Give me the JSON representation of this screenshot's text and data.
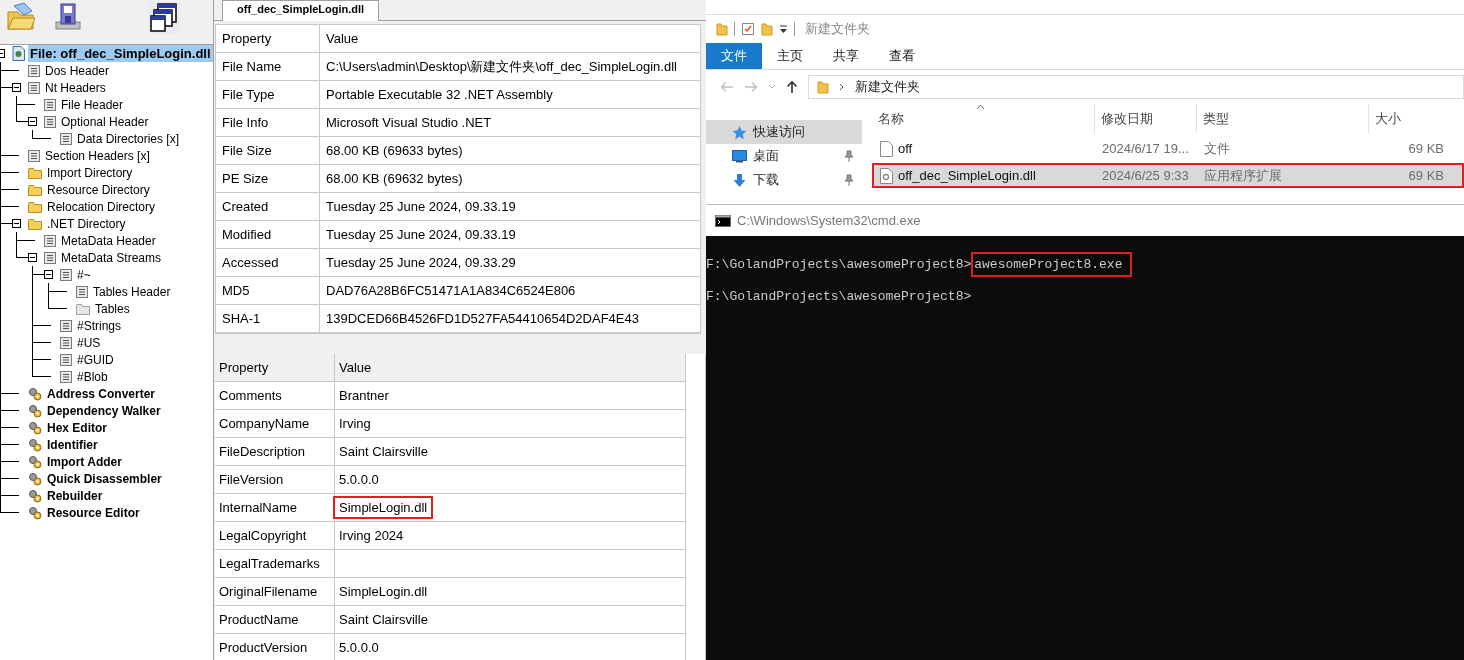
{
  "tree": [
    {
      "label": "File: off_dec_SimpleLogin.dll",
      "kind": "file",
      "selected": true,
      "expanded": true,
      "children": [
        {
          "label": "Dos Header",
          "kind": "page",
          "selected": false
        },
        {
          "label": "Nt Headers",
          "kind": "page",
          "selected": false,
          "expanded": true,
          "children": [
            {
              "label": "File Header",
              "kind": "page",
              "selected": false
            },
            {
              "label": "Optional Header",
              "kind": "page",
              "selected": false,
              "expanded": true,
              "children": [
                {
                  "label": "Data Directories [x]",
                  "kind": "page",
                  "selected": false
                }
              ]
            }
          ]
        },
        {
          "label": "Section Headers [x]",
          "kind": "page",
          "selected": false
        },
        {
          "label": "Import Directory",
          "kind": "folder",
          "selected": false
        },
        {
          "label": "Resource Directory",
          "kind": "folder",
          "selected": false
        },
        {
          "label": "Relocation Directory",
          "kind": "folder",
          "selected": false
        },
        {
          "label": ".NET Directory",
          "kind": "folder",
          "selected": false,
          "expanded": true,
          "children": [
            {
              "label": "MetaData Header",
              "kind": "page",
              "selected": false
            },
            {
              "label": "MetaData Streams",
              "kind": "page",
              "selected": false,
              "expanded": true,
              "children": [
                {
                  "label": "#~",
                  "kind": "page",
                  "selected": false,
                  "expanded": true,
                  "children": [
                    {
                      "label": "Tables Header",
                      "kind": "page",
                      "selected": false
                    },
                    {
                      "label": "Tables",
                      "kind": "folder-empty",
                      "selected": false
                    }
                  ]
                },
                {
                  "label": "#Strings",
                  "kind": "page",
                  "selected": false
                },
                {
                  "label": "#US",
                  "kind": "page",
                  "selected": false
                },
                {
                  "label": "#GUID",
                  "kind": "page",
                  "selected": false
                },
                {
                  "label": "#Blob",
                  "kind": "page",
                  "selected": false
                }
              ]
            }
          ]
        },
        {
          "label": "Address Converter",
          "kind": "tool",
          "selected": false
        },
        {
          "label": "Dependency Walker",
          "kind": "tool",
          "selected": false
        },
        {
          "label": "Hex Editor",
          "kind": "tool",
          "selected": false
        },
        {
          "label": "Identifier",
          "kind": "tool",
          "selected": false
        },
        {
          "label": "Import Adder",
          "kind": "tool",
          "selected": false
        },
        {
          "label": "Quick Disassembler",
          "kind": "tool",
          "selected": false
        },
        {
          "label": "Rebuilder",
          "kind": "tool",
          "selected": false
        },
        {
          "label": "Resource Editor",
          "kind": "tool",
          "selected": false
        }
      ]
    }
  ],
  "tabs": [
    {
      "label": "off_dec_SimpleLogin.dll",
      "selected": true
    }
  ],
  "file_table": {
    "columns": [
      "Property",
      "Value"
    ],
    "rows": [
      {
        "property": "File Name",
        "value": "C:\\Users\\admin\\Desktop\\新建文件夹\\off_dec_SimpleLogin.dll"
      },
      {
        "property": "File Type",
        "value": "Portable Executable 32 .NET Assembly"
      },
      {
        "property": "File Info",
        "value": "Microsoft Visual Studio .NET"
      },
      {
        "property": "File Size",
        "value": "68.00 KB (69633 bytes)"
      },
      {
        "property": "PE Size",
        "value": "68.00 KB (69632 bytes)"
      },
      {
        "property": "Created",
        "value": "Tuesday 25 June 2024, 09.33.19"
      },
      {
        "property": "Modified",
        "value": "Tuesday 25 June 2024, 09.33.19"
      },
      {
        "property": "Accessed",
        "value": "Tuesday 25 June 2024, 09.33.29"
      },
      {
        "property": "MD5",
        "value": "DAD76A28B6FC51471A1A834C6524E806"
      },
      {
        "property": "SHA-1",
        "value": "139DCED66B4526FD1D527FA54410654D2DAF4E43"
      }
    ]
  },
  "version_table": {
    "columns": [
      "Property",
      "Value"
    ],
    "rows": [
      {
        "property": "Comments",
        "value": "Brantner"
      },
      {
        "property": "CompanyName",
        "value": "Irving"
      },
      {
        "property": "FileDescription",
        "value": "Saint Clairsville"
      },
      {
        "property": "FileVersion",
        "value": "5.0.0.0"
      },
      {
        "property": "InternalName",
        "value": "SimpleLogin.dll",
        "highlighted": true
      },
      {
        "property": "LegalCopyright",
        "value": "Irving 2024"
      },
      {
        "property": "LegalTrademarks"
      },
      {
        "property": "OriginalFilename",
        "value": "SimpleLogin.dll"
      },
      {
        "property": "ProductName",
        "value": "Saint Clairsville"
      },
      {
        "property": "ProductVersion",
        "value": "5.0.0.0"
      }
    ]
  },
  "explorer": {
    "title": "新建文件夹",
    "ribbon_tabs": [
      {
        "label": "文件",
        "selected": true
      },
      {
        "label": "主页",
        "selected": false
      },
      {
        "label": "共享",
        "selected": false
      },
      {
        "label": "查看",
        "selected": false
      }
    ],
    "path": "新建文件夹",
    "nav": [
      {
        "label": "快速访问",
        "kind": "star",
        "selected": true,
        "pinned": false
      },
      {
        "label": "桌面",
        "kind": "desktop",
        "selected": false,
        "pinned": true
      },
      {
        "label": "下载",
        "kind": "download",
        "selected": false,
        "pinned": true
      }
    ],
    "columns": [
      "名称",
      "修改日期",
      "类型",
      "大小"
    ],
    "files": [
      {
        "name": "off",
        "modified": "2024/6/17 19...",
        "type": "文件",
        "size": "69 KB",
        "kind": "file",
        "selected": false,
        "highlighted": false
      },
      {
        "name": "off_dec_SimpleLogin.dll",
        "modified": "2024/6/25 9:33",
        "type": "应用程序扩展",
        "size": "69 KB",
        "kind": "dll",
        "selected": true,
        "highlighted": true
      }
    ]
  },
  "console": {
    "title": "C:\\Windows\\System32\\cmd.exe",
    "lines": [
      {
        "prompt": "F:\\GolandProjects\\awesomeProject8>",
        "command": "awesomeProject8.exe",
        "highlighted": true
      },
      {
        "prompt": "F:\\GolandProjects\\awesomeProject8>"
      }
    ]
  }
}
